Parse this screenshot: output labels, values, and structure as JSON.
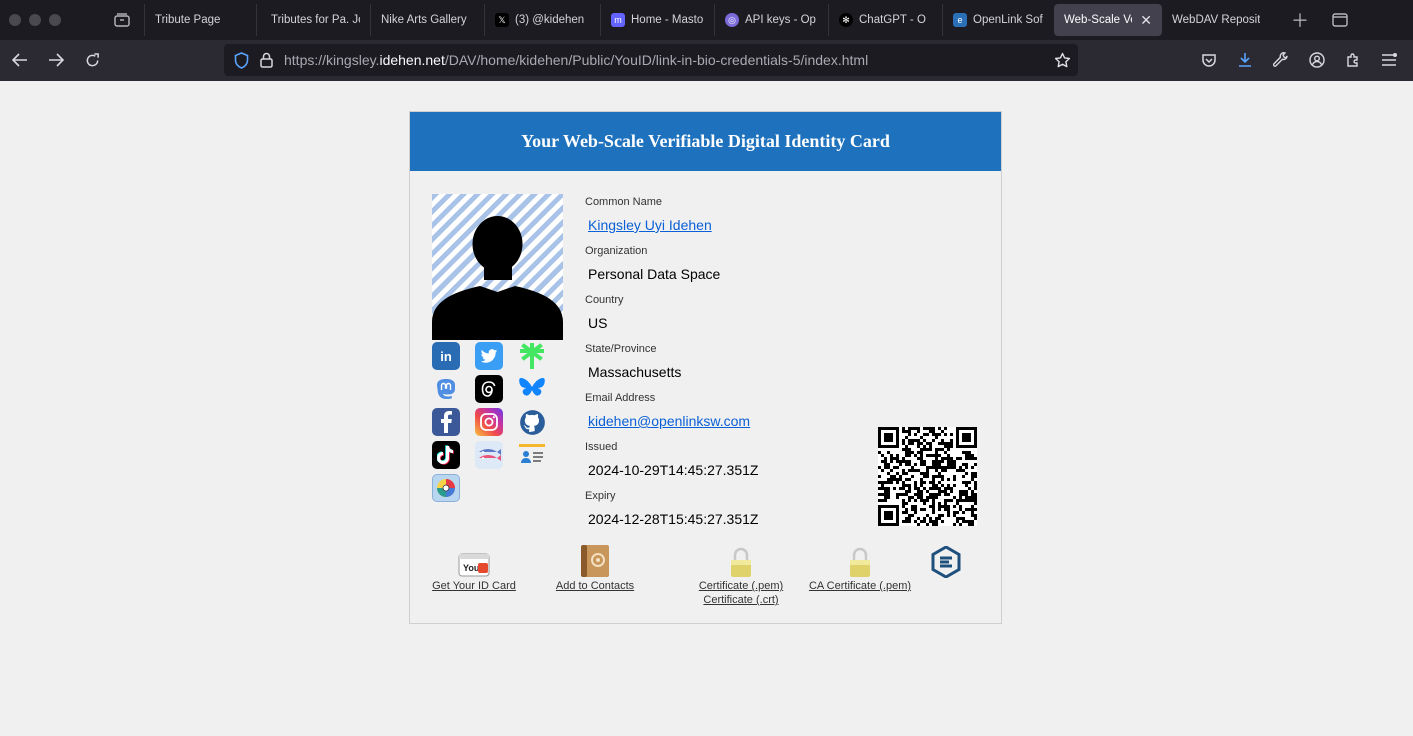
{
  "browser": {
    "tabs": [
      {
        "label": "Tribute Page",
        "favicon": "generic-page-icon",
        "color": "#1c1b22"
      },
      {
        "label": "Tributes for Pa. Jo",
        "favicon": "generic-page-icon",
        "color": "#1c1b22"
      },
      {
        "label": "Nike Arts Gallery",
        "favicon": "generic-page-icon",
        "color": "#1c1b22"
      },
      {
        "label": "(3) @kidehen",
        "favicon": "x-icon",
        "color": "#000000"
      },
      {
        "label": "Home - Masto",
        "favicon": "mastodon-icon",
        "color": "#6364ff"
      },
      {
        "label": "API keys - Op",
        "favicon": "openai-icon",
        "color": "#7a6bd8"
      },
      {
        "label": "ChatGPT - O",
        "favicon": "chatgpt-icon",
        "color": "#000000"
      },
      {
        "label": "OpenLink Sof",
        "favicon": "openlink-icon",
        "color": "#2a6fb8"
      },
      {
        "label": "Web-Scale Ver",
        "favicon": "none",
        "color": "#42414d",
        "active": true
      },
      {
        "label": "WebDAV Reposit",
        "favicon": "none",
        "color": "#1c1b22"
      }
    ],
    "url": {
      "prefix": "https://kingsley.",
      "domain": "idehen.net",
      "path": "/DAV/home/kidehen/Public/YouID/link-in-bio-credentials-5/index.html"
    }
  },
  "card": {
    "title": "Your Web-Scale Verifiable Digital Identity Card",
    "header_color": "#1e71bd",
    "fields": [
      {
        "label": "Common Name",
        "value": "Kingsley Uyi Idehen",
        "link": true
      },
      {
        "label": "Organization",
        "value": "Personal Data Space",
        "link": false
      },
      {
        "label": "Country",
        "value": "US",
        "link": false
      },
      {
        "label": "State/Province",
        "value": "Massachusetts",
        "link": false
      },
      {
        "label": "Email Address",
        "value": "kidehen@openlinksw.com",
        "link": true
      },
      {
        "label": "Issued",
        "value": "2024-10-29T14:45:27.351Z",
        "link": false
      },
      {
        "label": "Expiry",
        "value": "2024-12-28T15:45:27.351Z",
        "link": false
      }
    ],
    "socials": [
      "linkedin-icon",
      "twitter-icon",
      "linktree-icon",
      "mastodon-icon",
      "threads-icon",
      "bluesky-icon",
      "facebook-icon",
      "instagram-icon",
      "github-icon",
      "tiktok-icon",
      "fish-icon",
      "contact-card-icon",
      "globe-icon"
    ],
    "links": {
      "get_id": "Get Your ID Card",
      "add_contacts": "Add to Contacts",
      "cert_pem": "Certificate (.pem)",
      "cert_crt": "Certificate (.crt)",
      "ca_cert": "CA Certificate (.pem)"
    },
    "youid_badge": "YouID"
  }
}
